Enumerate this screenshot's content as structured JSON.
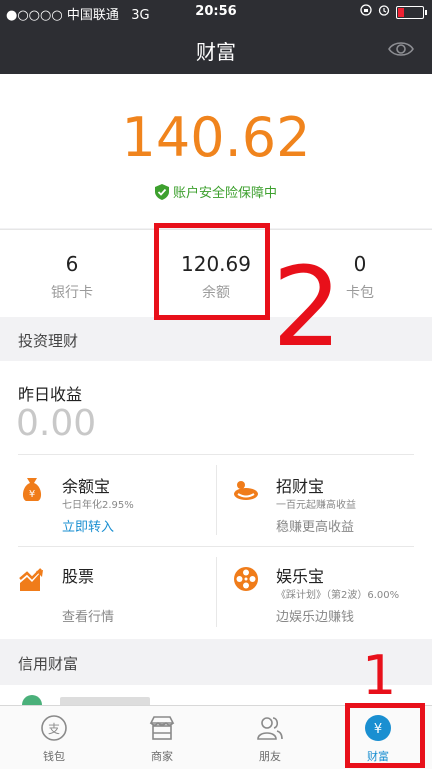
{
  "status_bar": {
    "carrier": "●○○○○ 中国联通",
    "network": "3G",
    "time": "20:56"
  },
  "nav": {
    "title": "财富",
    "eye_icon": "eye-icon"
  },
  "hero": {
    "total_amount": "140.62",
    "security_text": "账户安全险保障中"
  },
  "stats": [
    {
      "value": "6",
      "label": "银行卡"
    },
    {
      "value": "120.69",
      "label": "余额"
    },
    {
      "value": "0",
      "label": "卡包"
    }
  ],
  "invest": {
    "section_title": "投资理财",
    "yesterday_label": "昨日收益",
    "yesterday_value": "0.00",
    "tiles": [
      {
        "title": "余额宝",
        "sub": "七日年化2.95%",
        "action": "立即转入",
        "icon": "money-bag-icon"
      },
      {
        "title": "招财宝",
        "sub": "一百元起赚高收益",
        "action": "稳赚更高收益",
        "icon": "cat-paw-icon"
      },
      {
        "title": "股票",
        "sub": "",
        "action": "查看行情",
        "icon": "stock-chart-icon"
      },
      {
        "title": "娱乐宝",
        "sub": "《踩计划》（第2波）6.00%",
        "action": "边娱乐边赚钱",
        "icon": "film-reel-icon"
      }
    ]
  },
  "credit": {
    "section_title": "信用财富"
  },
  "tabbar": [
    {
      "label": "钱包",
      "icon": "wallet-icon"
    },
    {
      "label": "商家",
      "icon": "store-icon"
    },
    {
      "label": "朋友",
      "icon": "friends-icon"
    },
    {
      "label": "财富",
      "icon": "yuan-icon"
    }
  ],
  "annotations": {
    "label_1": "1",
    "label_2": "2"
  },
  "colors": {
    "accent_orange": "#f0841d",
    "accent_blue": "#1a8fd1",
    "secure_green": "#3da02e",
    "annotation_red": "#e8101a"
  }
}
